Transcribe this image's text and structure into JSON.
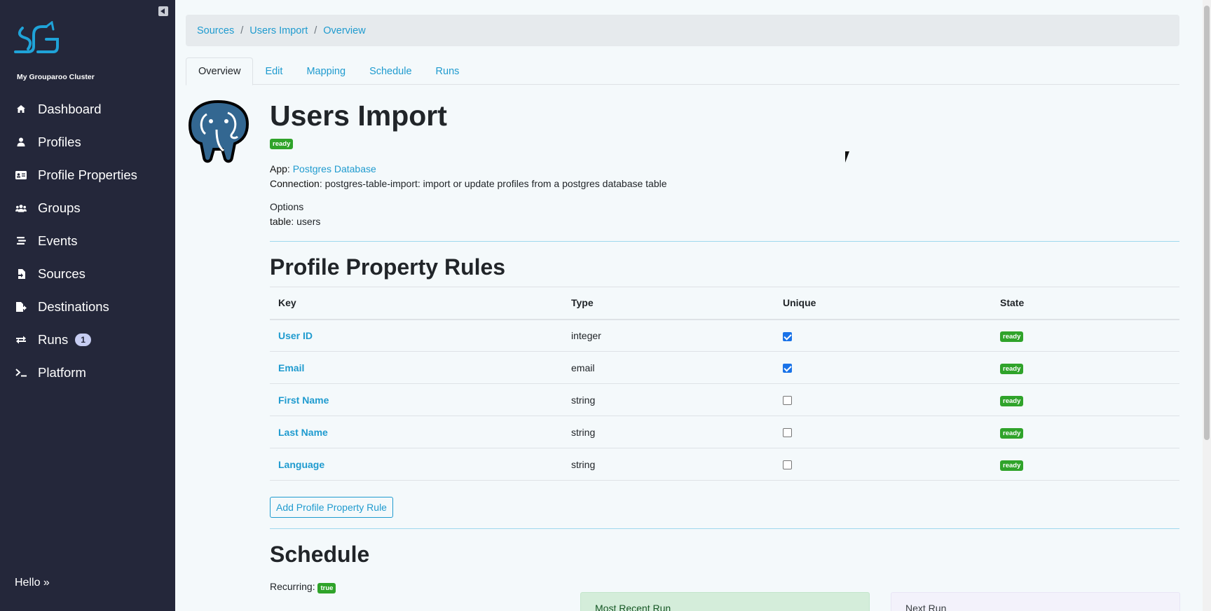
{
  "sidebar": {
    "cluster_name": "My Grouparoo Cluster",
    "items": [
      {
        "label": "Dashboard",
        "icon": "home-icon"
      },
      {
        "label": "Profiles",
        "icon": "user-icon"
      },
      {
        "label": "Profile Properties",
        "icon": "id-card-icon"
      },
      {
        "label": "Groups",
        "icon": "users-icon"
      },
      {
        "label": "Events",
        "icon": "stream-icon"
      },
      {
        "label": "Sources",
        "icon": "file-import-icon"
      },
      {
        "label": "Destinations",
        "icon": "file-export-icon"
      },
      {
        "label": "Runs",
        "icon": "exchange-icon",
        "badge": "1"
      },
      {
        "label": "Platform",
        "icon": "terminal-icon"
      }
    ],
    "footer": "Hello »"
  },
  "breadcrumb": [
    "Sources",
    "Users Import",
    "Overview"
  ],
  "tabs": [
    "Overview",
    "Edit",
    "Mapping",
    "Schedule",
    "Runs"
  ],
  "source": {
    "title": "Users Import",
    "state": "ready",
    "app_label": "App",
    "app_value": "Postgres Database",
    "connection_label": "Connection",
    "connection_value": "postgres-table-import: import or update profiles from a postgres database table",
    "options_label": "Options",
    "option_key": "table",
    "option_value": "users"
  },
  "rules": {
    "heading": "Profile Property Rules",
    "columns": [
      "Key",
      "Type",
      "Unique",
      "State"
    ],
    "rows": [
      {
        "key": "User ID",
        "type": "integer",
        "unique": true,
        "state": "ready"
      },
      {
        "key": "Email",
        "type": "email",
        "unique": true,
        "state": "ready"
      },
      {
        "key": "First Name",
        "type": "string",
        "unique": false,
        "state": "ready"
      },
      {
        "key": "Last Name",
        "type": "string",
        "unique": false,
        "state": "ready"
      },
      {
        "key": "Language",
        "type": "string",
        "unique": false,
        "state": "ready"
      }
    ],
    "add_button": "Add Profile Property Rule"
  },
  "schedule": {
    "heading": "Schedule",
    "recurring_label": "Recurring",
    "recurring_value": "true",
    "most_recent_run": "Most Recent Run",
    "next_run": "Next Run"
  },
  "colors": {
    "sidebar_bg": "#24273a",
    "accent": "#1f9bcf",
    "ready_badge": "#2fa32a"
  }
}
